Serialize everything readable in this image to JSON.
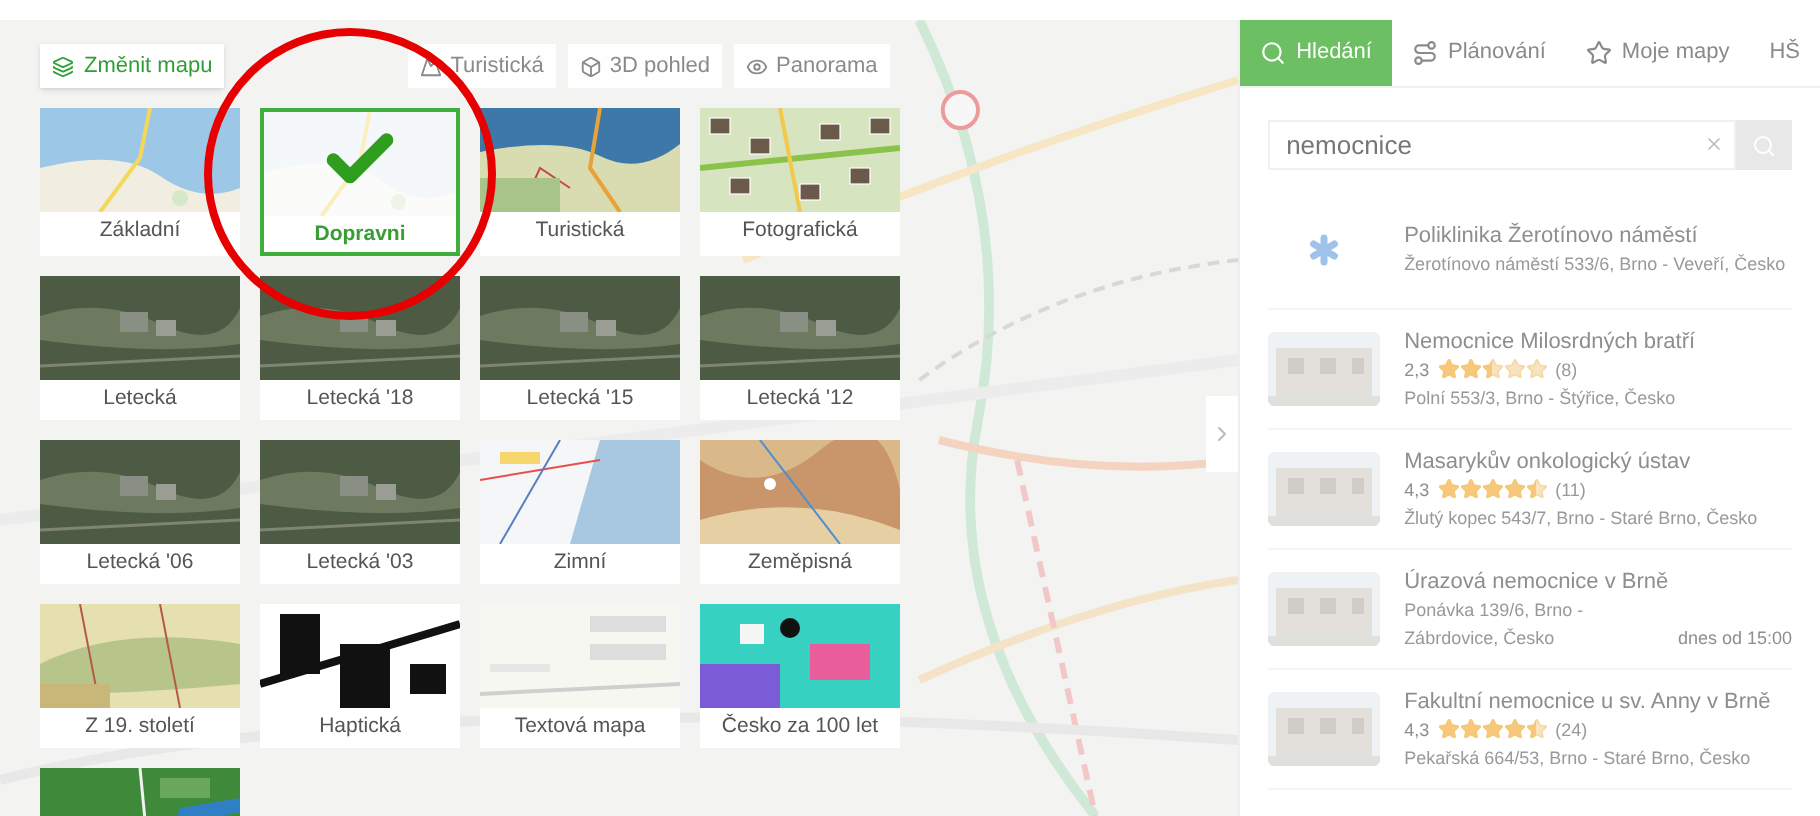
{
  "toolbar": {
    "change_map": "Změnit mapu",
    "buttons": [
      {
        "label": "Turistická"
      },
      {
        "label": "3D pohled"
      },
      {
        "label": "Panorama"
      }
    ]
  },
  "map_types": [
    {
      "label": "Základní",
      "selected": false,
      "kind": "basic"
    },
    {
      "label": "Dopravni",
      "selected": true,
      "kind": "traffic"
    },
    {
      "label": "Turistická",
      "selected": false,
      "kind": "tourist"
    },
    {
      "label": "Fotografická",
      "selected": false
    },
    {
      "label": "Letecká",
      "selected": false,
      "kind": "aerial"
    },
    {
      "label": "Letecká '18",
      "selected": false,
      "kind": "aerial"
    },
    {
      "label": "Letecká '15",
      "selected": false,
      "kind": "aerial"
    },
    {
      "label": "Letecká '12",
      "selected": false,
      "kind": "aerial"
    },
    {
      "label": "Letecká '06",
      "selected": false,
      "kind": "aerial"
    },
    {
      "label": "Letecká '03",
      "selected": false,
      "kind": "aerial"
    },
    {
      "label": "Zimní",
      "selected": false,
      "kind": "winter"
    },
    {
      "label": "Zeměpisná",
      "selected": false,
      "kind": "geo"
    },
    {
      "label": "Z 19. století",
      "selected": false,
      "kind": "old"
    },
    {
      "label": "Haptická",
      "selected": false,
      "kind": "tactile"
    },
    {
      "label": "Textová mapa",
      "selected": false,
      "kind": "text"
    },
    {
      "label": "Česko za 100 let",
      "selected": false,
      "kind": "future"
    },
    {
      "kind": "river"
    }
  ],
  "panel": {
    "tabs": [
      {
        "label": "Hledání",
        "selected": true
      },
      {
        "label": "Plánování",
        "selected": false
      },
      {
        "label": "Moje mapy",
        "selected": false
      },
      {
        "label": "HŠ",
        "selected": false
      }
    ],
    "search": {
      "value": "nemocnice"
    },
    "results": [
      {
        "name": "Poliklinika Žerotínovo náměstí",
        "address": "Žerotínovo náměstí 533/6, Brno - Veveří, Česko",
        "kind": "clinic"
      },
      {
        "name": "Nemocnice Milosrdných bratří",
        "rating": "2,3",
        "stars": 2.5,
        "count": "(8)",
        "address": "Polní 553/3, Brno - Štýřice, Česko"
      },
      {
        "name": "Masarykův onkologický ústav",
        "rating": "4,3",
        "stars": 4.5,
        "count": "(11)",
        "address": "Žlutý kopec 543/7, Brno - Staré Brno, Česko"
      },
      {
        "name": "Úrazová nemocnice v Brně",
        "address": "Ponávka 139/6, Brno - Zábrdovice, Česko",
        "hours": "dnes od 15:00"
      },
      {
        "name": "Fakultní nemocnice u sv. Anny v Brně",
        "rating": "4,3",
        "stars": 4.5,
        "count": "(24)",
        "address": "Pekařská 664/53, Brno - Staré Brno, Česko"
      }
    ]
  }
}
